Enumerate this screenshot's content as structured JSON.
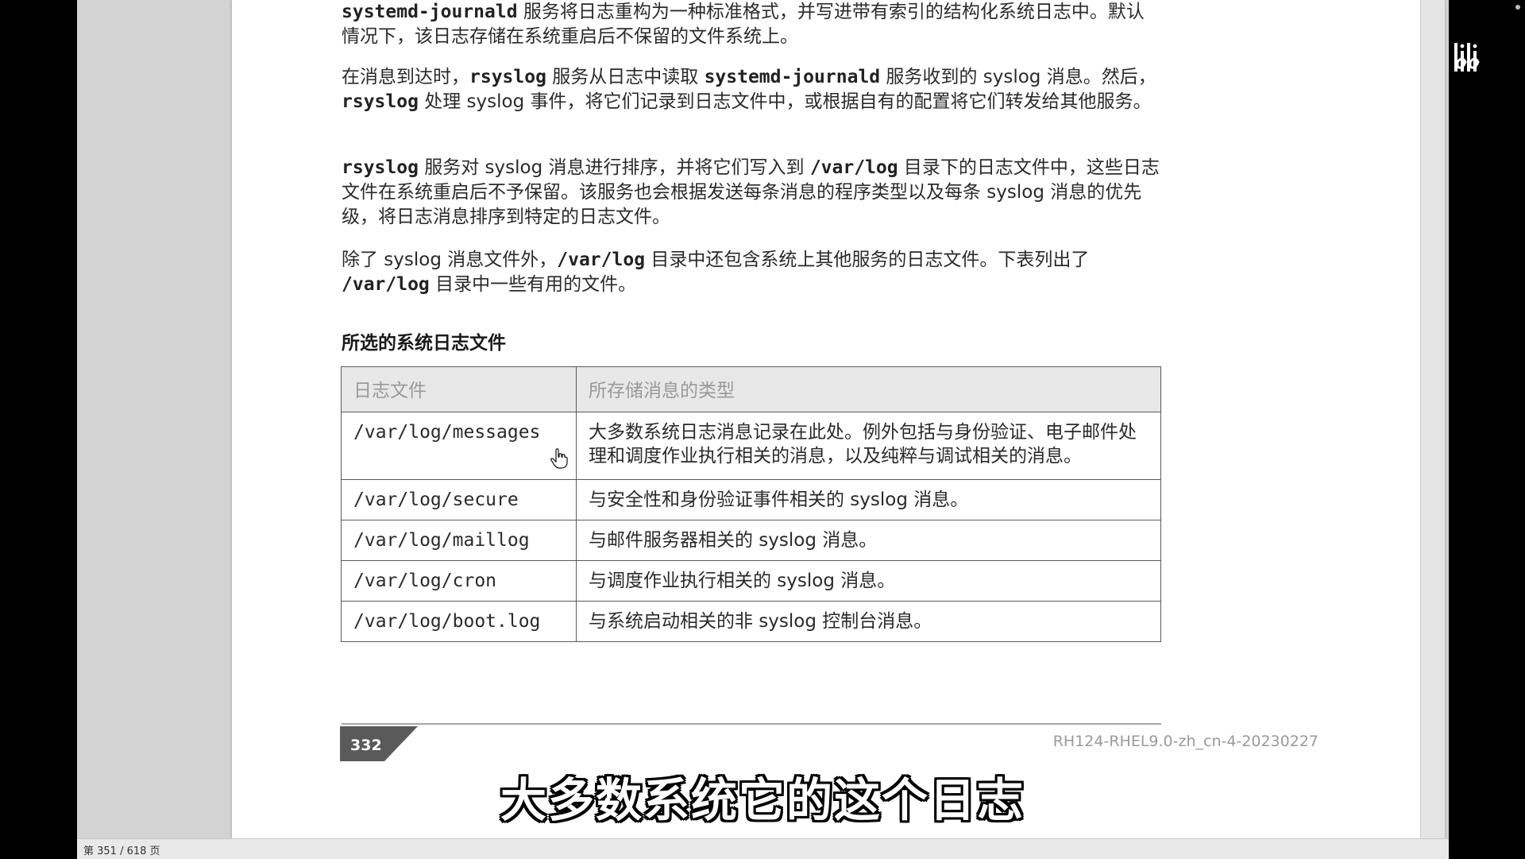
{
  "paragraphs": [
    {
      "parts": [
        {
          "code": true,
          "text": "systemd-journald"
        },
        {
          "code": false,
          "text": " 服务将日志重构为一种标准格式，并写进带有索引的结构化系统日志中。默认情况下，该日志存储在系统重启后不保留的文件系统上。"
        }
      ]
    },
    {
      "parts": [
        {
          "code": false,
          "text": "在消息到达时，"
        },
        {
          "code": true,
          "text": "rsyslog"
        },
        {
          "code": false,
          "text": " 服务从日志中读取 "
        },
        {
          "code": true,
          "text": "systemd-journald"
        },
        {
          "code": false,
          "text": " 服务收到的 syslog 消息。然后，"
        },
        {
          "code": true,
          "text": "rsyslog"
        },
        {
          "code": false,
          "text": " 处理 syslog 事件，将它们记录到日志文件中，或根据自有的配置将它们转发给其他服务。"
        }
      ]
    },
    {
      "parts": [
        {
          "code": true,
          "text": "rsyslog"
        },
        {
          "code": false,
          "text": " 服务对 syslog 消息进行排序，并将它们写入到 "
        },
        {
          "code": true,
          "text": "/var/log"
        },
        {
          "code": false,
          "text": " 目录下的日志文件中，这些日志文件在系统重启后不予保留。该服务也会根据发送每条消息的程序类型以及每条 syslog 消息的优先级，将日志消息排序到特定的日志文件。"
        }
      ]
    },
    {
      "parts": [
        {
          "code": false,
          "text": "除了 syslog 消息文件外，"
        },
        {
          "code": true,
          "text": "/var/log"
        },
        {
          "code": false,
          "text": " 目录中还包含系统上其他服务的日志文件。下表列出了 "
        },
        {
          "code": true,
          "text": "/var/log"
        },
        {
          "code": false,
          "text": " 目录中一些有用的文件。"
        }
      ]
    }
  ],
  "section_title": "所选的系统日志文件",
  "table": {
    "headers": [
      "日志文件",
      "所存储消息的类型"
    ],
    "rows": [
      {
        "file": "/var/log/messages",
        "desc": "大多数系统日志消息记录在此处。例外包括与身份验证、电子邮件处理和调度作业执行相关的消息，以及纯粹与调试相关的消息。"
      },
      {
        "file": "/var/log/secure",
        "desc": "与安全性和身份验证事件相关的 syslog 消息。"
      },
      {
        "file": "/var/log/maillog",
        "desc": "与邮件服务器相关的 syslog 消息。"
      },
      {
        "file": "/var/log/cron",
        "desc": "与调度作业执行相关的 syslog 消息。"
      },
      {
        "file": "/var/log/boot.log",
        "desc": "与系统启动相关的非 syslog 控制台消息。"
      }
    ]
  },
  "footer": {
    "page_number": "332",
    "doc_id": "RH124-RHEL9.0-zh_cn-4-20230227"
  },
  "subtitle": "大多数系统它的这个日志",
  "status_bar": {
    "page_indicator": "第 351 / 618 页"
  },
  "icons": {
    "cursor": "hand-pointer-icon",
    "logo": "bilibili-logo"
  },
  "colors": {
    "subtitle_text": "#ffffff",
    "badge": "#5a5a5a"
  }
}
